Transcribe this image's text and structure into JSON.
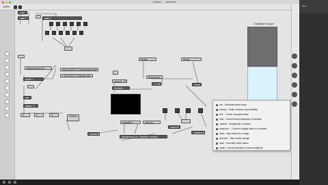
{
  "window": {
    "title": "1 (Max) … unlocked"
  },
  "toolbar": {
    "zoom": "100%"
  },
  "right_panel": {
    "label": "Ins..."
  },
  "canvas": {
    "objects": {
      "o1": "print",
      "o2": "gate 1",
      "o3": "gate 1",
      "o4": "sfold 44100 0.3 downloaded.wav",
      "o5": "L R 44100 0 3 sample.wav",
      "o6": "append name $1",
      "o7": "route s",
      "o8": "set",
      "o9": "sfplay~ 2",
      "o10": "0.",
      "o11": "0.",
      "o12": "0.",
      "o13": "timeline",
      "o14": "groove~ 4 buf",
      "o15": "jit.matrix",
      "o16": "*~ 0.5",
      "o17": "poly~ sfile",
      "o18": "ffd.tail",
      "o19": "ffd.tail",
      "o20": "sample $1",
      "o21": "pack 0 0",
      "o22": "flonum vpc",
      "o23": "snapshot~",
      "o24": "plot.voc.",
      "o25": "scale $1",
      "o26": "autostopped-pp_distance_breaker",
      "o27": "subsample $1",
      "o28": "print",
      "o29": "scope $1"
    },
    "scope_label": "Oscillator Scope"
  },
  "popup_menu": {
    "items": [
      "bar - Generate stereo ramp",
      "dummy - Scale numbers exponentially",
      "line~ - Linear ramp generator",
      "mstr - Convert linear amplitude to decibels",
      "number - Display/edit a number",
      "snapshot~ - Convert a signal value to a number",
      "scale - Map values to a range",
      "jit.matrix - Jitter matrix storage",
      "ease - Smoothly ramp values",
      "atodb - Convert decibels to linear amplitude"
    ]
  }
}
